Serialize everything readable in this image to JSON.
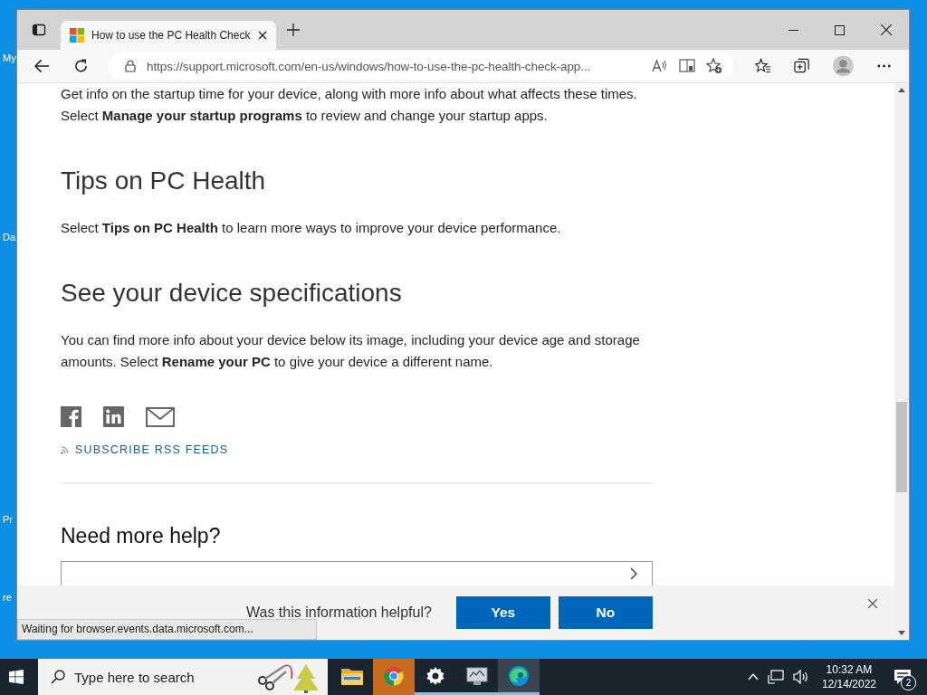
{
  "desktop": {
    "icon_labels": [
      "My",
      "Da",
      "Pr",
      "re"
    ]
  },
  "browser": {
    "tabs": [
      {
        "title": "How to use the PC Health Check",
        "selected": true
      }
    ],
    "address": "https://support.microsoft.com/en-us/windows/how-to-use-the-pc-health-check-app...",
    "status": "Waiting for browser.events.data.microsoft.com..."
  },
  "article": {
    "blocks": [
      {
        "kind": "paragraph",
        "text": "Get info on the startup time for your device, along with more info about what affects these times. Select **Manage your startup programs** to review and change your startup apps."
      },
      {
        "kind": "heading",
        "text": "Tips on PC Health"
      },
      {
        "kind": "paragraph",
        "text": "Select **Tips on PC Health** to learn more ways to improve your device performance."
      },
      {
        "kind": "heading",
        "text": "See your device specifications"
      },
      {
        "kind": "paragraph",
        "text": "You can find more info about your device below its image, including your device age and storage amounts. Select **Rename your PC** to give your device a different name."
      }
    ],
    "rss": "SUBSCRIBE RSS FEEDS",
    "help_heading": "Need more help?"
  },
  "feedback": {
    "question": "Was this information helpful?",
    "buttons": [
      "Yes",
      "No"
    ]
  },
  "taskbar": {
    "search_placeholder": "Type here to search",
    "apps": [
      {
        "kind": "folder",
        "running": false,
        "selected": false
      },
      {
        "kind": "chrome",
        "running": false,
        "selected": true
      },
      {
        "kind": "gear",
        "running": true,
        "selected": false
      },
      {
        "kind": "monitor",
        "running": true,
        "selected": false
      },
      {
        "kind": "edge",
        "running": true,
        "selected": true
      }
    ],
    "time": "10:32 AM",
    "date": "12/14/2022",
    "notification_count": "2"
  }
}
